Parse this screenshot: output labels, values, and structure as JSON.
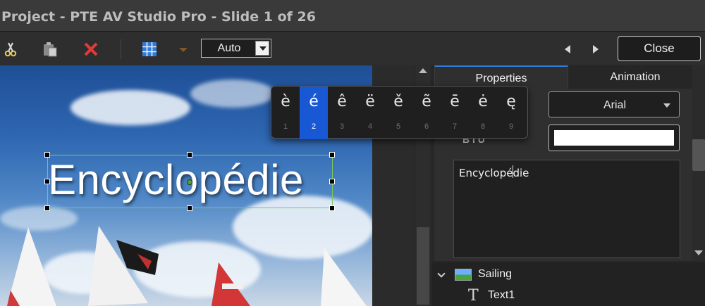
{
  "window": {
    "title": "Project - PTE AV Studio Pro - Slide 1 of 26"
  },
  "toolbar": {
    "zoom_value": "Auto",
    "close_label": "Close"
  },
  "slide": {
    "text": "Encyclopédie"
  },
  "accent_popup": {
    "options": [
      {
        "char": "è",
        "key": "1"
      },
      {
        "char": "é",
        "key": "2"
      },
      {
        "char": "ê",
        "key": "3"
      },
      {
        "char": "ë",
        "key": "4"
      },
      {
        "char": "ě",
        "key": "5"
      },
      {
        "char": "ẽ",
        "key": "6"
      },
      {
        "char": "ē",
        "key": "7"
      },
      {
        "char": "ė",
        "key": "8"
      },
      {
        "char": "ę",
        "key": "9"
      }
    ],
    "selected_index": 1
  },
  "panel": {
    "tabs": [
      {
        "label": "Properties"
      },
      {
        "label": "Animation"
      }
    ],
    "font": "Arial",
    "text_color": "#ffffff",
    "text_value": "Encyclopédie",
    "style_buttons": "B  I  U"
  },
  "tree": {
    "items": [
      {
        "label": "Sailing"
      },
      {
        "label": "Text1"
      }
    ]
  },
  "colors": {
    "accent": "#1858d4",
    "tab_accent": "#2d7de0",
    "selection": "#7ec95a"
  }
}
